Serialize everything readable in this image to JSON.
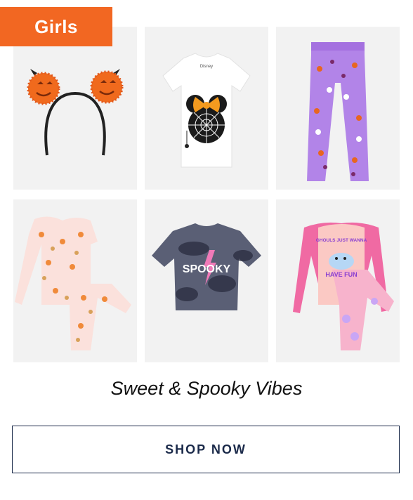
{
  "category_badge": {
    "label": "Girls",
    "color": "#f26722"
  },
  "products": [
    {
      "name": "pumpkin-pom-pom-headband"
    },
    {
      "name": "minnie-spiderweb-graphic-tee",
      "tag_text": "Disney"
    },
    {
      "name": "purple-halloween-leggings"
    },
    {
      "name": "pink-pumpkin-print-pajamas"
    },
    {
      "name": "spooky-tie-dye-tee",
      "shirt_text": "SPOOKY"
    },
    {
      "name": "ghouls-have-fun-pajamas",
      "shirt_text_top": "GHOULS JUST WANNA",
      "shirt_text_bottom": "HAVE FUN"
    }
  ],
  "tagline": "Sweet & Spooky Vibes",
  "cta": {
    "label": "SHOP NOW",
    "color": "#1b2a4a"
  }
}
